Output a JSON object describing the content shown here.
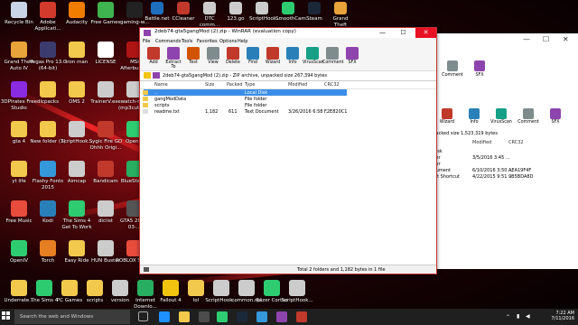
{
  "desktop": {
    "icons": [
      {
        "label": "Recycle Bin",
        "color": "#c9d4e6"
      },
      {
        "label": "Adobe Applicati...",
        "color": "#d23b2c"
      },
      {
        "label": "Audacity",
        "color": "#f07c00"
      },
      {
        "label": "Free Games",
        "color": "#3fb34f"
      },
      {
        "label": "gaming-w...",
        "color": "#222"
      },
      {
        "label": "Grand Theft Auto IV",
        "color": "#e8a33a"
      },
      {
        "label": "Vegas Pro 13.0 (64-bit)",
        "color": "#3b3b6d"
      },
      {
        "label": "iron man",
        "color": "#f2c94c"
      },
      {
        "label": "LICENSE",
        "color": "#fff"
      },
      {
        "label": "MSI Afterburner",
        "color": "#b01515"
      },
      {
        "label": "3DPIrates Free Studio",
        "color": "#8a2be2"
      },
      {
        "label": "dlcpacks",
        "color": "#f2c94c"
      },
      {
        "label": "OMS 2",
        "color": "#f2c94c"
      },
      {
        "label": "TrainerV.exe",
        "color": "#ccc"
      },
      {
        "label": "watch-mp3 (mp3cut.net)",
        "color": "#ccc"
      },
      {
        "label": "gta 4",
        "color": "#f2c94c"
      },
      {
        "label": "New folder (2)",
        "color": "#f2c94c"
      },
      {
        "label": "ScriptHook...",
        "color": "#ccc"
      },
      {
        "label": "Sygic Fire GD Ohhh Origi...",
        "color": "#c0392b"
      },
      {
        "label": "OpenIV",
        "color": "#2ecc71"
      },
      {
        "label": "yt life",
        "color": "#f2c94c"
      },
      {
        "label": "Flashy Fonts 2015",
        "color": "#3498db"
      },
      {
        "label": "Aimcap",
        "color": "#ccc"
      },
      {
        "label": "Bandicam",
        "color": "#c0392b"
      },
      {
        "label": "BlueStacks",
        "color": "#27ae60"
      },
      {
        "label": "Free Music",
        "color": "#e74c3c"
      },
      {
        "label": "Kodi",
        "color": "#2980b9"
      },
      {
        "label": "The Sims 4 Get To Work",
        "color": "#2ecc71"
      },
      {
        "label": "dlclist",
        "color": "#ccc"
      },
      {
        "label": "GTA5 2016-03-...",
        "color": "#555"
      },
      {
        "label": "OpenIV",
        "color": "#2ecc71"
      },
      {
        "label": "Torch",
        "color": "#e67e22"
      },
      {
        "label": "Easy Ride",
        "color": "#f2c94c"
      },
      {
        "label": "HUN Buster",
        "color": "#ccc"
      },
      {
        "label": "ROBLOX Studio",
        "color": "#e74c3c"
      },
      {
        "label": "Underrate...",
        "color": "#f2c94c"
      },
      {
        "label": "The Sims 4",
        "color": "#2ecc71"
      },
      {
        "label": "PC Games",
        "color": "#f2c94c"
      },
      {
        "label": "scripts",
        "color": "#f2c94c"
      },
      {
        "label": "version",
        "color": "#ccc"
      },
      {
        "label": "Internet Downlo...",
        "color": "#27ae60"
      },
      {
        "label": "Fallout 4",
        "color": "#f1c40f"
      },
      {
        "label": "lol",
        "color": "#f2c94c"
      },
      {
        "label": "ScriptHook...",
        "color": "#ccc"
      },
      {
        "label": "common.rpf",
        "color": "#ccc"
      },
      {
        "label": "Razer Cortex",
        "color": "#2ecc71"
      },
      {
        "label": "ScriptHook...",
        "color": "#ccc"
      }
    ],
    "top_icons_right": [
      {
        "label": "Battle.net",
        "color": "#1f6fbf"
      },
      {
        "label": "CCleaner",
        "color": "#c0392b"
      },
      {
        "label": "DTC comm...",
        "color": "#ccc"
      },
      {
        "label": "123.go",
        "color": "#ccc"
      },
      {
        "label": "ScriptHook...",
        "color": "#ccc"
      },
      {
        "label": "SmoothCam...",
        "color": "#2ecc71"
      },
      {
        "label": "Steam",
        "color": "#1b2838"
      },
      {
        "label": "Grand Theft",
        "color": "#e8a33a"
      }
    ]
  },
  "main_window": {
    "title": "2deb74-gta5gangMod (2).zip - WinRAR (evaluation copy)",
    "menu": [
      "File",
      "Commands",
      "Tools",
      "Favorites",
      "Options",
      "Help"
    ],
    "toolbar": [
      {
        "label": "Add",
        "color": "#c0392b"
      },
      {
        "label": "Extract To",
        "color": "#8e44ad"
      },
      {
        "label": "Test",
        "color": "#d35400"
      },
      {
        "label": "View",
        "color": "#7f8c8d"
      },
      {
        "label": "Delete",
        "color": "#c0392b"
      },
      {
        "label": "Find",
        "color": "#2980b9"
      },
      {
        "label": "Wizard",
        "color": "#c0392b"
      },
      {
        "label": "Info",
        "color": "#2980b9"
      },
      {
        "label": "VirusScan",
        "color": "#16a085"
      },
      {
        "label": "Comment",
        "color": "#7f8c8d"
      },
      {
        "label": "SFX",
        "color": "#8e44ad"
      }
    ],
    "path": "2deb74-gta5gangMod (2).zip - ZIP archive, unpacked size 267,394 bytes",
    "columns": [
      "Name",
      "Size",
      "Packed",
      "Type",
      "Modified",
      "CRC32"
    ],
    "rows": [
      {
        "name": "..",
        "size": "",
        "packed": "",
        "type": "Local Disk",
        "modified": "",
        "crc": ""
      },
      {
        "name": "gangModData",
        "size": "",
        "packed": "",
        "type": "File folder",
        "modified": "",
        "crc": ""
      },
      {
        "name": "scripts",
        "size": "",
        "packed": "",
        "type": "File folder",
        "modified": "",
        "crc": ""
      },
      {
        "name": "readme.txt",
        "size": "1,182",
        "packed": "611",
        "type": "Text Document",
        "modified": "3/26/2016 6:58 ...",
        "crc": "F2E820C1"
      }
    ],
    "status": "Total 2 folders and 1,182 bytes in 1 file"
  },
  "bg_window": {
    "toolbar": [
      "Comment",
      "SFX"
    ],
    "toolbar2": [
      "Wizard",
      "Info",
      "VirusScan",
      "Comment",
      "SFX"
    ],
    "path": "unpacked size 1,523,319 bytes",
    "columns": [
      "Modified",
      "CRC32"
    ],
    "rows": [
      {
        "type": "al Disk",
        "modified": "",
        "crc": ""
      },
      {
        "type": "folder",
        "modified": "3/5/2016 3:45 ...",
        "crc": ""
      },
      {
        "type": "folder",
        "modified": "",
        "crc": ""
      },
      {
        "type": "Document",
        "modified": "6/10/2016 3:50 ...",
        "crc": "AEA19F4F"
      },
      {
        "type": "ment Shortcut",
        "modified": "4/22/2015 9:51 ...",
        "crc": "9B5BDA8D"
      }
    ]
  },
  "taskbar": {
    "search_placeholder": "Search the web and Windows",
    "time": "7:22 AM",
    "date": "7/11/2016"
  }
}
